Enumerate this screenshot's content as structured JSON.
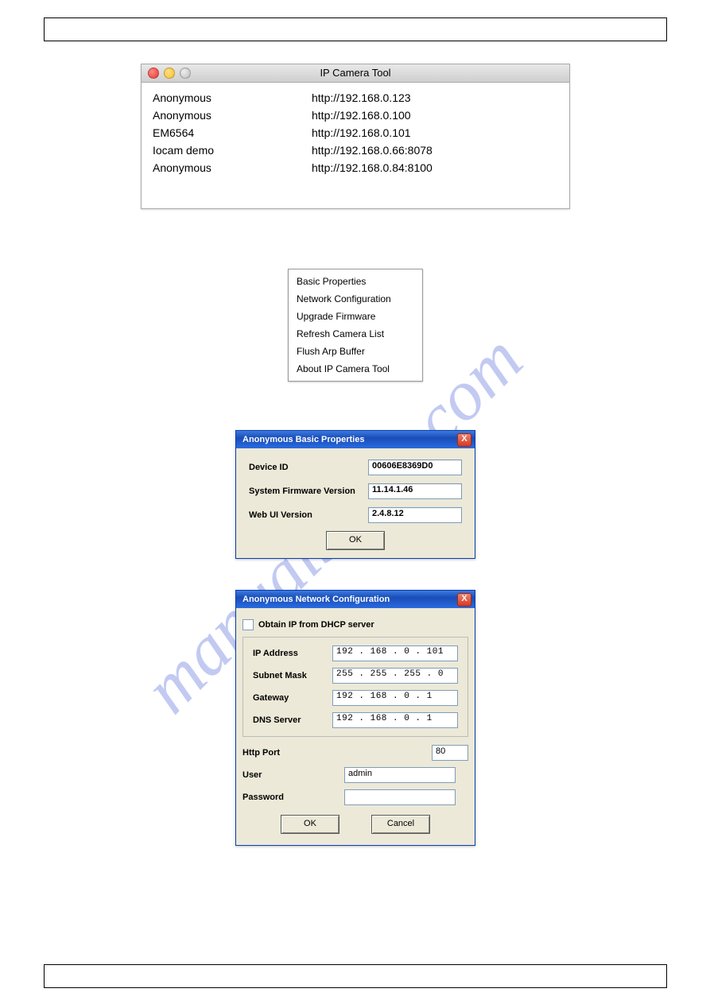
{
  "watermark": "manualshive.com",
  "mac_window": {
    "title": "IP Camera Tool",
    "rows": [
      {
        "name": "Anonymous",
        "url": "http://192.168.0.123"
      },
      {
        "name": "Anonymous",
        "url": "http://192.168.0.100"
      },
      {
        "name": "EM6564",
        "url": "http://192.168.0.101"
      },
      {
        "name": "Iocam demo",
        "url": "http://192.168.0.66:8078"
      },
      {
        "name": "Anonymous",
        "url": "http://192.168.0.84:8100"
      }
    ]
  },
  "context_menu": {
    "items": [
      "Basic Properties",
      "Network Configuration",
      "Upgrade Firmware",
      "Refresh Camera List",
      "Flush Arp Buffer",
      "About IP Camera Tool"
    ]
  },
  "basic_props": {
    "title": "Anonymous Basic Properties",
    "close": "X",
    "rows": {
      "device_id_label": "Device ID",
      "device_id_value": "00606E8369D0",
      "fw_label": "System Firmware Version",
      "fw_value": "11.14.1.46",
      "web_label": "Web UI Version",
      "web_value": "2.4.8.12"
    },
    "ok": "OK"
  },
  "net_cfg": {
    "title": "Anonymous Network Configuration",
    "close": "X",
    "dhcp_label": "Obtain IP from DHCP server",
    "fields": {
      "ip_label": "IP Address",
      "ip_value": "192 . 168 .  0  . 101",
      "mask_label": "Subnet Mask",
      "mask_value": "255 . 255 . 255 .  0",
      "gw_label": "Gateway",
      "gw_value": "192 . 168 .  0  .  1",
      "dns_label": "DNS Server",
      "dns_value": "192 . 168 .  0  .  1"
    },
    "http_port_label": "Http Port",
    "http_port_value": "80",
    "user_label": "User",
    "user_value": "admin",
    "pwd_label": "Password",
    "pwd_value": "",
    "ok": "OK",
    "cancel": "Cancel"
  }
}
